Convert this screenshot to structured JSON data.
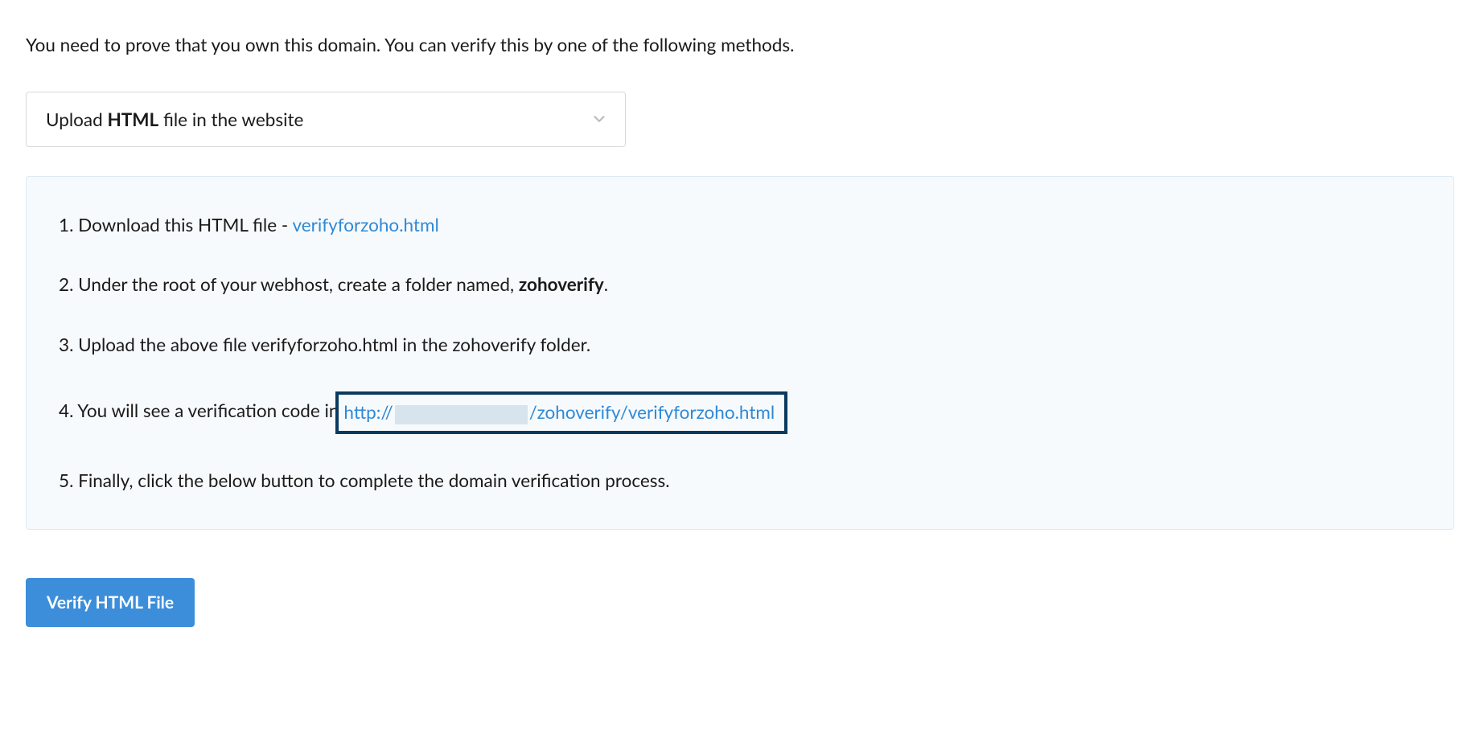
{
  "intro": "You need to prove that you own this domain. You can verify this by one of the following methods.",
  "select": {
    "prefix": "Upload ",
    "bold": "HTML",
    "suffix": " file in the website"
  },
  "steps": {
    "s1_prefix": "Download this HTML file - ",
    "s1_link": "verifyforzoho.html",
    "s2_prefix": "Under the root of your webhost, create a folder named, ",
    "s2_bold": "zohoverify",
    "s2_suffix": ".",
    "s3": "Upload the above file verifyforzoho.html in the zohoverify folder.",
    "s4_prefix": "You will see a verification code in",
    "s4_url_pre": "http://",
    "s4_url_post": "/zohoverify/verifyforzoho.html",
    "s5": "Finally, click the below button to complete the domain verification process."
  },
  "button": {
    "verify_label": "Verify HTML File"
  }
}
